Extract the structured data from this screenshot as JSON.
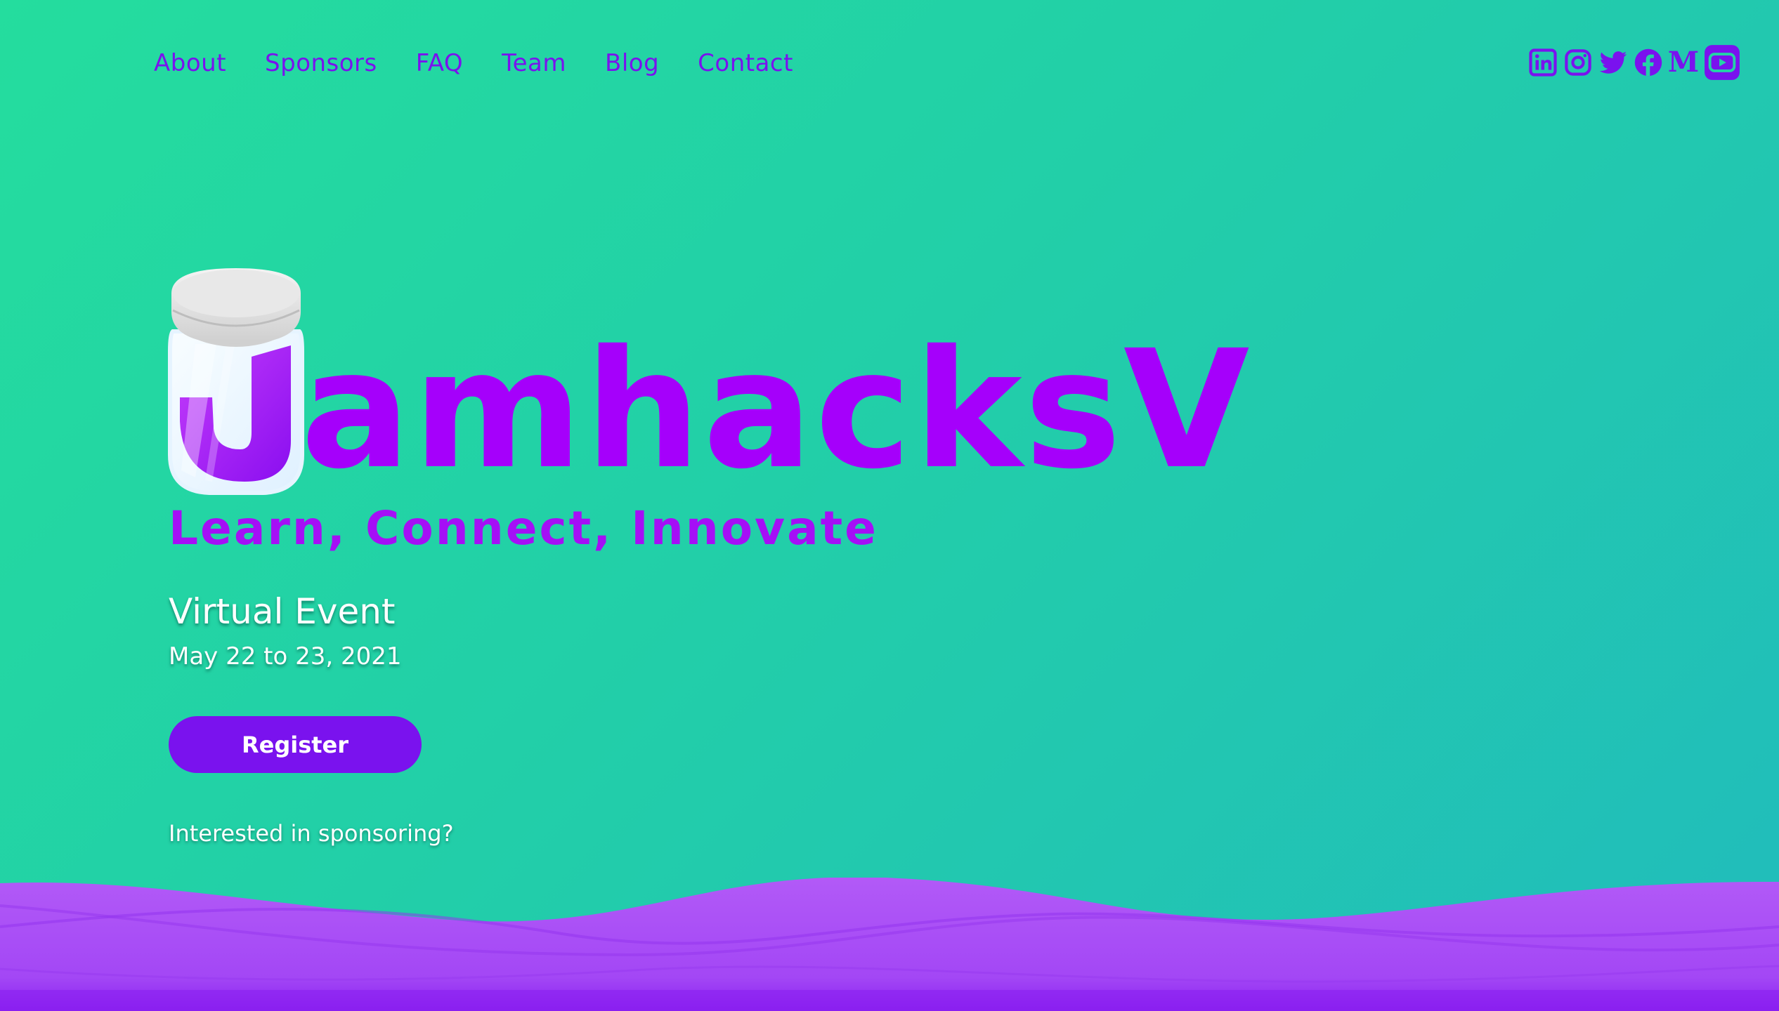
{
  "nav": {
    "links": [
      {
        "label": "About"
      },
      {
        "label": "Sponsors"
      },
      {
        "label": "FAQ"
      },
      {
        "label": "Team"
      },
      {
        "label": "Blog"
      },
      {
        "label": "Contact"
      }
    ]
  },
  "social": {
    "icons": [
      "linkedin-icon",
      "instagram-icon",
      "twitter-icon",
      "facebook-icon",
      "medium-icon",
      "youtube-icon"
    ],
    "medium_glyph": "M"
  },
  "hero": {
    "logo_text": "amhacksV",
    "tagline": "Learn, Connect, Innovate",
    "event_type": "Virtual Event",
    "event_date": "May 22 to 23, 2021",
    "register_label": "Register",
    "sponsor_link": "Interested in sponsoring?"
  },
  "colors": {
    "accent_purple": "#7a12ee",
    "logo_purple": "#a500fb",
    "background_start": "#24dd9e",
    "background_end": "#21bcbc",
    "wave_purple": "#a64bf4"
  }
}
